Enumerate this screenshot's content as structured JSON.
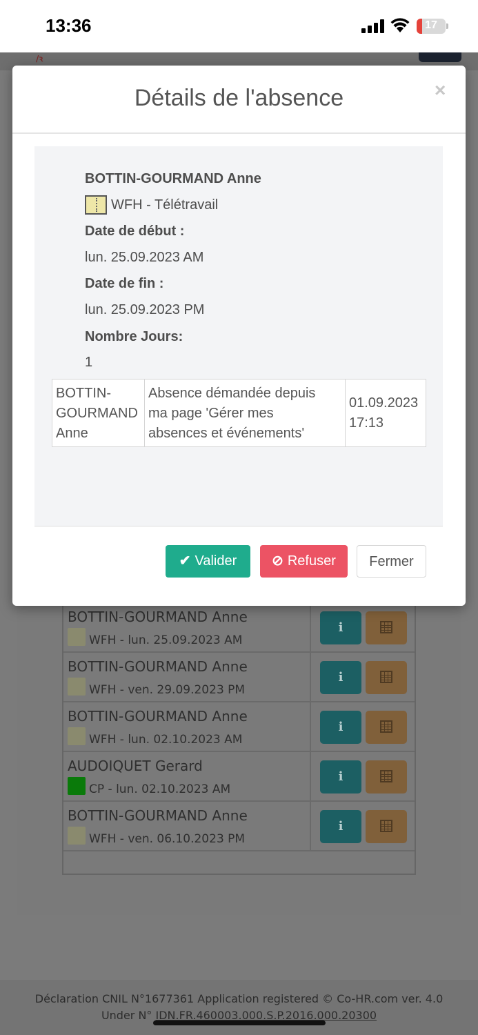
{
  "status_bar": {
    "time": "13:36",
    "battery": "17"
  },
  "modal": {
    "title": "Détails de l'absence",
    "close_symbol": "×",
    "employee": "BOTTIN-GOURMAND Anne",
    "absence_type": "WFH - Télétravail",
    "absence_type_color": "#eee7a8",
    "start_label": "Date de début :",
    "start_value": "lun. 25.09.2023 AM",
    "end_label": "Date de fin :",
    "end_value": "lun. 25.09.2023 PM",
    "days_label": "Nombre Jours:",
    "days_value": "1",
    "history": {
      "author": "BOTTIN-GOURMAND Anne",
      "author_lines": [
        "BOTTIN-",
        "GOURMAND",
        "Anne"
      ],
      "comment_lines": [
        "Absence démandée depuis",
        "ma page 'Gérer mes",
        "absences et événements'"
      ],
      "date_lines": [
        "01.09.2023",
        "17:13"
      ]
    },
    "buttons": {
      "validate": "Valider",
      "refuse": "Refuser",
      "close": "Fermer"
    }
  },
  "background_list": {
    "rows": [
      {
        "name": "BOTTIN-GOURMAND Anne",
        "code": "WFH",
        "detail": " - lun. 25.09.2023 AM",
        "color": "#8a8a6e"
      },
      {
        "name": "BOTTIN-GOURMAND Anne",
        "code": "WFH",
        "detail": " - ven. 29.09.2023 PM",
        "color": "#8a8a6e"
      },
      {
        "name": "BOTTIN-GOURMAND Anne",
        "code": "WFH",
        "detail": " - lun. 02.10.2023 AM",
        "color": "#8a8a6e"
      },
      {
        "name": "AUDOIQUET Gerard",
        "code": "CP",
        "detail": " - lun. 02.10.2023 AM",
        "color": "#0a7a0a"
      },
      {
        "name": "BOTTIN-GOURMAND Anne",
        "code": "WFH",
        "detail": " - ven. 06.10.2023 PM",
        "color": "#8a8a6e"
      }
    ],
    "info_button": "i"
  },
  "footer": {
    "line1": "Déclaration CNIL N°1677361    Application registered    © Co-HR.com ver. 4.0",
    "line2_prefix": "Under N° ",
    "line2_id": "IDN.FR.460003.000.S.P.2016.000.20300"
  }
}
